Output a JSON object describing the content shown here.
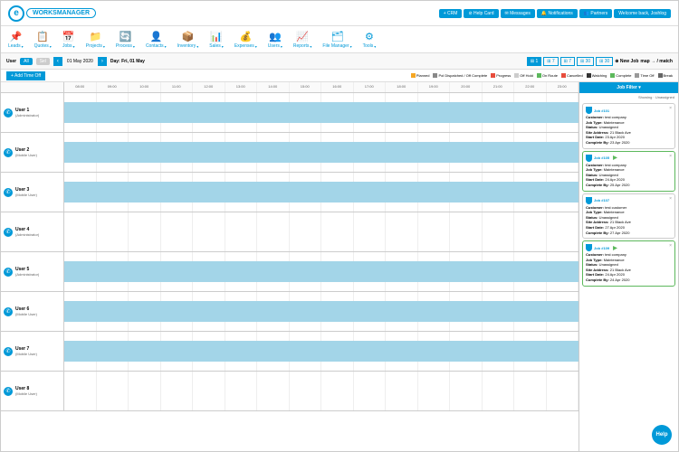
{
  "logo": {
    "e": "e",
    "text": "WORKSMANAGER"
  },
  "top_buttons": [
    {
      "label": "+ CRM"
    },
    {
      "label": "⊘ Help Card"
    },
    {
      "label": "✉ Messages"
    },
    {
      "label": "🔔 Notifications"
    },
    {
      "label": "👥 Partners"
    },
    {
      "label": "Welcome back, Joshlog"
    }
  ],
  "menu": [
    {
      "icon": "📌",
      "label": "Leads"
    },
    {
      "icon": "📋",
      "label": "Quotes"
    },
    {
      "icon": "📅",
      "label": "Jobs"
    },
    {
      "icon": "📁",
      "label": "Projects"
    },
    {
      "icon": "🔄",
      "label": "Process"
    },
    {
      "icon": "👤",
      "label": "Contacts"
    },
    {
      "icon": "📦",
      "label": "Inventory"
    },
    {
      "icon": "📊",
      "label": "Sales"
    },
    {
      "icon": "💰",
      "label": "Expenses"
    },
    {
      "icon": "👥",
      "label": "Users"
    },
    {
      "icon": "📈",
      "label": "Reports"
    },
    {
      "icon": "🗂",
      "label": "File Manager"
    },
    {
      "icon": "⚙",
      "label": "Tools"
    }
  ],
  "toolbar": {
    "user_label": "User",
    "all": "All",
    "sel": "Sel",
    "date_prev": "01 May 2020",
    "day_label": "Day: Fri, 01 May",
    "views": [
      "⊞ 1",
      "⊞ 7",
      "⊞ 7",
      "⊞ 30",
      "⊞ 30"
    ],
    "new_job": "⊕ New Job",
    "map": "map → / match"
  },
  "add_time_off": "+ Add Time Off",
  "legends": [
    {
      "c": "#f5a623",
      "t": "Planned"
    },
    {
      "c": "#888",
      "t": "Pol Dispatched / Off Complete"
    },
    {
      "c": "#e74c3c",
      "t": "Progress"
    },
    {
      "c": "#ccc",
      "t": "Off Hold"
    },
    {
      "c": "#5cb85c",
      "t": "On Route"
    },
    {
      "c": "#e74c3c",
      "t": "Cancelled"
    },
    {
      "c": "#333",
      "t": "Watching"
    },
    {
      "c": "#5cb85c",
      "t": "Complete"
    },
    {
      "c": "#999",
      "t": "Time Off"
    },
    {
      "c": "#666",
      "t": "Break"
    }
  ],
  "times": [
    "08:00",
    "09:00",
    "10:00",
    "11:00",
    "12:00",
    "13:00",
    "14:00",
    "15:00",
    "16:00",
    "17:00",
    "18:00",
    "19:00",
    "20:00",
    "21:00",
    "22:00",
    "23:00"
  ],
  "users": [
    {
      "name": "User 1",
      "role": "(Administrator)",
      "band": true
    },
    {
      "name": "User 2",
      "role": "(Mobile User)",
      "band": true
    },
    {
      "name": "User 3",
      "role": "(Mobile User)",
      "band": true
    },
    {
      "name": "User 4",
      "role": "(Administrator)",
      "band": false
    },
    {
      "name": "User 5",
      "role": "(Administrator)",
      "band": true
    },
    {
      "name": "User 6",
      "role": "(Mobile User)",
      "band": true
    },
    {
      "name": "User 7",
      "role": "(Mobile User)",
      "band": true
    },
    {
      "name": "User 8",
      "role": "(Mobile User)",
      "band": false
    }
  ],
  "sidebar": {
    "title": "Job Filter ▾",
    "status": "Showing · Unassigned",
    "jobs": [
      {
        "id": "Job #101",
        "customer": "test company",
        "type": "Maintenance",
        "status": "Unassigned",
        "addr": "21 Black Ave",
        "start": "23 Apr 2020",
        "complete": "23 Apr 2020",
        "active": false
      },
      {
        "id": "Job #105",
        "customer": "test company",
        "type": "Maintenance",
        "status": "Unassigned",
        "start": "24 Apr 2020",
        "complete": "25 Apr 2020",
        "active": true
      },
      {
        "id": "Job #107",
        "customer": "test customer",
        "type": "Maintenance",
        "status": "Unassigned",
        "addr": "21 Black Ave",
        "start": "27 Apr 2020",
        "complete": "27 Apr 2020",
        "active": false
      },
      {
        "id": "Job #109",
        "customer": "test company",
        "type": "Maintenance",
        "status": "Unassigned",
        "addr": "21 Black Ave",
        "start": "24 Apr 2020",
        "complete": "24 Apr 2020",
        "active": true
      }
    ]
  },
  "help": "Help"
}
